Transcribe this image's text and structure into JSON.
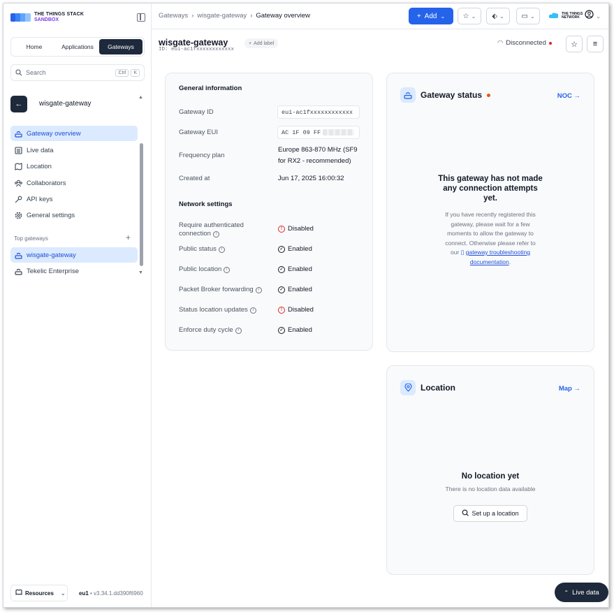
{
  "brand": {
    "line1": "THE THINGS STACK",
    "line2": "SANDBOX"
  },
  "tabs": [
    "Home",
    "Applications",
    "Gateways"
  ],
  "search": {
    "placeholder": "Search",
    "kbd1": "Ctrl",
    "kbd2": "K"
  },
  "sidebar": {
    "gateway_name": "wisgate-gateway",
    "items": [
      {
        "label": "Gateway overview",
        "icon": "router-icon"
      },
      {
        "label": "Live data",
        "icon": "list-icon"
      },
      {
        "label": "Location",
        "icon": "map-icon"
      },
      {
        "label": "Collaborators",
        "icon": "users-icon"
      },
      {
        "label": "API keys",
        "icon": "key-icon"
      },
      {
        "label": "General settings",
        "icon": "gear-icon"
      }
    ],
    "top_gateways_label": "Top gateways",
    "top_gateways": [
      {
        "label": "wisgate-gateway"
      },
      {
        "label": "Tekelic Enterprise"
      }
    ],
    "resources": "Resources",
    "region": "eu1",
    "version": "v3.34.1.dd390f6960"
  },
  "breadcrumb": [
    "Gateways",
    "wisgate-gateway",
    "Gateway overview"
  ],
  "topbar": {
    "add": "Add",
    "network_line1": "THE THINGS",
    "network_line2": "NETWORK"
  },
  "header": {
    "title": "wisgate-gateway",
    "id": "ID: eui-ac1fxxxxxxxxxxxx",
    "add_label": "Add label",
    "connection": "Disconnected"
  },
  "general": {
    "title": "General information",
    "gateway_id_label": "Gateway ID",
    "gateway_id": "eui-ac1fxxxxxxxxxxxx",
    "gateway_eui_label": "Gateway EUI",
    "gateway_eui": "AC 1F 09 FF",
    "freq_label": "Frequency plan",
    "freq_line1": "Europe 863-870 MHz (SF9",
    "freq_line2": "for RX2 - recommended)",
    "created_label": "Created at",
    "created": "Jun 17, 2025 16:00:32"
  },
  "network": {
    "title": "Network settings",
    "rows": [
      {
        "label1": "Require authenticated",
        "label2": "connection",
        "value": "Disabled",
        "ok": false
      },
      {
        "label1": "Public status",
        "value": "Enabled",
        "ok": true
      },
      {
        "label1": "Public location",
        "value": "Enabled",
        "ok": true
      },
      {
        "label1": "Packet Broker forwarding",
        "value": "Enabled",
        "ok": true
      },
      {
        "label1": "Status location updates",
        "value": "Disabled",
        "ok": false
      },
      {
        "label1": "Enforce duty cycle",
        "value": "Enabled",
        "ok": true
      }
    ]
  },
  "status_card": {
    "title": "Gateway status",
    "link": "NOC →",
    "msg_line1": "This gateway has not made",
    "msg_line2": "any connection attempts",
    "msg_line3": "yet.",
    "sub1": "If you have recently registered this",
    "sub2": "gateway, please wait for a few",
    "sub3": "moments to allow the gateway to",
    "sub4": "connect. Otherwise please refer to",
    "sub5_prefix": "our",
    "sub5_link": "gateway troubleshooting",
    "sub6_link": "documentation",
    "sub6_suffix": "."
  },
  "location_card": {
    "title": "Location",
    "link": "Map →",
    "empty": "No location yet",
    "empty_sub": "There is no location data available",
    "button": "Set up a location"
  },
  "live_data": "Live data",
  "colors": {
    "accent": "#2563eb",
    "dark": "#1e293b",
    "brand_purple": "#7c3aed",
    "error": "#dc2626",
    "status_dot": "#ea580c"
  }
}
